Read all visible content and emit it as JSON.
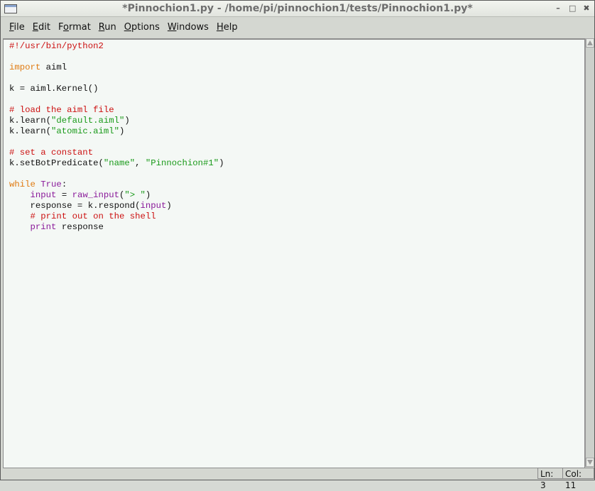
{
  "window": {
    "title": "*Pinnochion1.py - /home/pi/pinnochion1/tests/Pinnochion1.py*",
    "controls": {
      "minimize": "–",
      "maximize": "□",
      "close": "✖"
    }
  },
  "menubar": [
    {
      "mnemonic": "F",
      "rest": "ile"
    },
    {
      "mnemonic": "E",
      "rest": "dit"
    },
    {
      "pre": "F",
      "mnemonic": "o",
      "rest": "rmat"
    },
    {
      "mnemonic": "R",
      "rest": "un"
    },
    {
      "mnemonic": "O",
      "rest": "ptions"
    },
    {
      "mnemonic": "W",
      "rest": "indows"
    },
    {
      "mnemonic": "H",
      "rest": "elp"
    }
  ],
  "editor": {
    "lines": [
      [
        {
          "t": "#!/usr/bin/python2",
          "c": "comment"
        }
      ],
      [],
      [
        {
          "t": "import",
          "c": "kw"
        },
        {
          "t": " aiml"
        }
      ],
      [],
      [
        {
          "t": "k = aiml.Kernel()"
        }
      ],
      [],
      [
        {
          "t": "# load the aiml file",
          "c": "comment"
        }
      ],
      [
        {
          "t": "k.learn("
        },
        {
          "t": "\"default.aiml\"",
          "c": "str"
        },
        {
          "t": ")"
        }
      ],
      [
        {
          "t": "k.learn("
        },
        {
          "t": "\"atomic.aiml\"",
          "c": "str"
        },
        {
          "t": ")"
        }
      ],
      [],
      [
        {
          "t": "# set a constant",
          "c": "comment"
        }
      ],
      [
        {
          "t": "k.setBotPredicate("
        },
        {
          "t": "\"name\"",
          "c": "str"
        },
        {
          "t": ", "
        },
        {
          "t": "\"Pinnochion#1\"",
          "c": "str"
        },
        {
          "t": ")"
        }
      ],
      [],
      [
        {
          "t": "while",
          "c": "kw"
        },
        {
          "t": " "
        },
        {
          "t": "True",
          "c": "bi"
        },
        {
          "t": ":"
        }
      ],
      [
        {
          "t": "    "
        },
        {
          "t": "input",
          "c": "bi"
        },
        {
          "t": " = "
        },
        {
          "t": "raw_input",
          "c": "bi"
        },
        {
          "t": "("
        },
        {
          "t": "\"> \"",
          "c": "str"
        },
        {
          "t": ")"
        }
      ],
      [
        {
          "t": "    response = k.respond("
        },
        {
          "t": "input",
          "c": "bi"
        },
        {
          "t": ")"
        }
      ],
      [
        {
          "t": "    "
        },
        {
          "t": "# print out on the shell",
          "c": "comment"
        }
      ],
      [
        {
          "t": "    "
        },
        {
          "t": "print",
          "c": "bi"
        },
        {
          "t": " response"
        }
      ]
    ]
  },
  "statusbar": {
    "line": "Ln: 3",
    "col": "Col: 11"
  }
}
